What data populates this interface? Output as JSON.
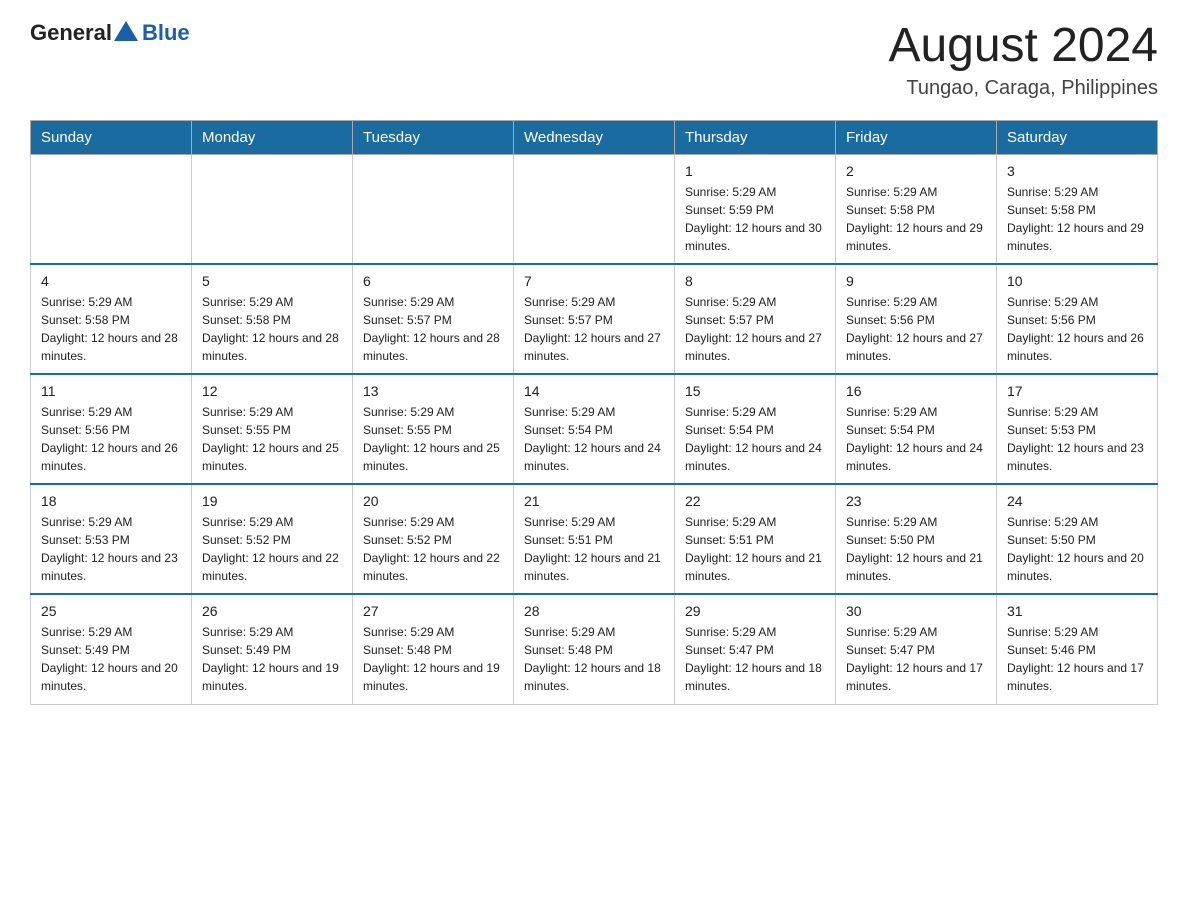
{
  "header": {
    "logo_general": "General",
    "logo_blue": "Blue",
    "month_year": "August 2024",
    "location": "Tungao, Caraga, Philippines"
  },
  "days_of_week": [
    "Sunday",
    "Monday",
    "Tuesday",
    "Wednesday",
    "Thursday",
    "Friday",
    "Saturday"
  ],
  "weeks": [
    [
      {
        "day": "",
        "sunrise": "",
        "sunset": "",
        "daylight": ""
      },
      {
        "day": "",
        "sunrise": "",
        "sunset": "",
        "daylight": ""
      },
      {
        "day": "",
        "sunrise": "",
        "sunset": "",
        "daylight": ""
      },
      {
        "day": "",
        "sunrise": "",
        "sunset": "",
        "daylight": ""
      },
      {
        "day": "1",
        "sunrise": "Sunrise: 5:29 AM",
        "sunset": "Sunset: 5:59 PM",
        "daylight": "Daylight: 12 hours and 30 minutes."
      },
      {
        "day": "2",
        "sunrise": "Sunrise: 5:29 AM",
        "sunset": "Sunset: 5:58 PM",
        "daylight": "Daylight: 12 hours and 29 minutes."
      },
      {
        "day": "3",
        "sunrise": "Sunrise: 5:29 AM",
        "sunset": "Sunset: 5:58 PM",
        "daylight": "Daylight: 12 hours and 29 minutes."
      }
    ],
    [
      {
        "day": "4",
        "sunrise": "Sunrise: 5:29 AM",
        "sunset": "Sunset: 5:58 PM",
        "daylight": "Daylight: 12 hours and 28 minutes."
      },
      {
        "day": "5",
        "sunrise": "Sunrise: 5:29 AM",
        "sunset": "Sunset: 5:58 PM",
        "daylight": "Daylight: 12 hours and 28 minutes."
      },
      {
        "day": "6",
        "sunrise": "Sunrise: 5:29 AM",
        "sunset": "Sunset: 5:57 PM",
        "daylight": "Daylight: 12 hours and 28 minutes."
      },
      {
        "day": "7",
        "sunrise": "Sunrise: 5:29 AM",
        "sunset": "Sunset: 5:57 PM",
        "daylight": "Daylight: 12 hours and 27 minutes."
      },
      {
        "day": "8",
        "sunrise": "Sunrise: 5:29 AM",
        "sunset": "Sunset: 5:57 PM",
        "daylight": "Daylight: 12 hours and 27 minutes."
      },
      {
        "day": "9",
        "sunrise": "Sunrise: 5:29 AM",
        "sunset": "Sunset: 5:56 PM",
        "daylight": "Daylight: 12 hours and 27 minutes."
      },
      {
        "day": "10",
        "sunrise": "Sunrise: 5:29 AM",
        "sunset": "Sunset: 5:56 PM",
        "daylight": "Daylight: 12 hours and 26 minutes."
      }
    ],
    [
      {
        "day": "11",
        "sunrise": "Sunrise: 5:29 AM",
        "sunset": "Sunset: 5:56 PM",
        "daylight": "Daylight: 12 hours and 26 minutes."
      },
      {
        "day": "12",
        "sunrise": "Sunrise: 5:29 AM",
        "sunset": "Sunset: 5:55 PM",
        "daylight": "Daylight: 12 hours and 25 minutes."
      },
      {
        "day": "13",
        "sunrise": "Sunrise: 5:29 AM",
        "sunset": "Sunset: 5:55 PM",
        "daylight": "Daylight: 12 hours and 25 minutes."
      },
      {
        "day": "14",
        "sunrise": "Sunrise: 5:29 AM",
        "sunset": "Sunset: 5:54 PM",
        "daylight": "Daylight: 12 hours and 24 minutes."
      },
      {
        "day": "15",
        "sunrise": "Sunrise: 5:29 AM",
        "sunset": "Sunset: 5:54 PM",
        "daylight": "Daylight: 12 hours and 24 minutes."
      },
      {
        "day": "16",
        "sunrise": "Sunrise: 5:29 AM",
        "sunset": "Sunset: 5:54 PM",
        "daylight": "Daylight: 12 hours and 24 minutes."
      },
      {
        "day": "17",
        "sunrise": "Sunrise: 5:29 AM",
        "sunset": "Sunset: 5:53 PM",
        "daylight": "Daylight: 12 hours and 23 minutes."
      }
    ],
    [
      {
        "day": "18",
        "sunrise": "Sunrise: 5:29 AM",
        "sunset": "Sunset: 5:53 PM",
        "daylight": "Daylight: 12 hours and 23 minutes."
      },
      {
        "day": "19",
        "sunrise": "Sunrise: 5:29 AM",
        "sunset": "Sunset: 5:52 PM",
        "daylight": "Daylight: 12 hours and 22 minutes."
      },
      {
        "day": "20",
        "sunrise": "Sunrise: 5:29 AM",
        "sunset": "Sunset: 5:52 PM",
        "daylight": "Daylight: 12 hours and 22 minutes."
      },
      {
        "day": "21",
        "sunrise": "Sunrise: 5:29 AM",
        "sunset": "Sunset: 5:51 PM",
        "daylight": "Daylight: 12 hours and 21 minutes."
      },
      {
        "day": "22",
        "sunrise": "Sunrise: 5:29 AM",
        "sunset": "Sunset: 5:51 PM",
        "daylight": "Daylight: 12 hours and 21 minutes."
      },
      {
        "day": "23",
        "sunrise": "Sunrise: 5:29 AM",
        "sunset": "Sunset: 5:50 PM",
        "daylight": "Daylight: 12 hours and 21 minutes."
      },
      {
        "day": "24",
        "sunrise": "Sunrise: 5:29 AM",
        "sunset": "Sunset: 5:50 PM",
        "daylight": "Daylight: 12 hours and 20 minutes."
      }
    ],
    [
      {
        "day": "25",
        "sunrise": "Sunrise: 5:29 AM",
        "sunset": "Sunset: 5:49 PM",
        "daylight": "Daylight: 12 hours and 20 minutes."
      },
      {
        "day": "26",
        "sunrise": "Sunrise: 5:29 AM",
        "sunset": "Sunset: 5:49 PM",
        "daylight": "Daylight: 12 hours and 19 minutes."
      },
      {
        "day": "27",
        "sunrise": "Sunrise: 5:29 AM",
        "sunset": "Sunset: 5:48 PM",
        "daylight": "Daylight: 12 hours and 19 minutes."
      },
      {
        "day": "28",
        "sunrise": "Sunrise: 5:29 AM",
        "sunset": "Sunset: 5:48 PM",
        "daylight": "Daylight: 12 hours and 18 minutes."
      },
      {
        "day": "29",
        "sunrise": "Sunrise: 5:29 AM",
        "sunset": "Sunset: 5:47 PM",
        "daylight": "Daylight: 12 hours and 18 minutes."
      },
      {
        "day": "30",
        "sunrise": "Sunrise: 5:29 AM",
        "sunset": "Sunset: 5:47 PM",
        "daylight": "Daylight: 12 hours and 17 minutes."
      },
      {
        "day": "31",
        "sunrise": "Sunrise: 5:29 AM",
        "sunset": "Sunset: 5:46 PM",
        "daylight": "Daylight: 12 hours and 17 minutes."
      }
    ]
  ]
}
